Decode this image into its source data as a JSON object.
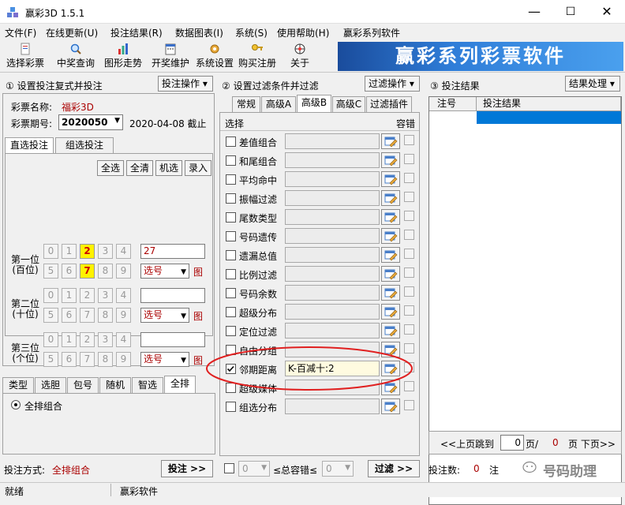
{
  "window": {
    "title": "赢彩3D 1.5.1",
    "minimize": "—",
    "maximize": "☐",
    "close": "✕"
  },
  "menu": [
    "文件(F)",
    "在线更新(U)",
    "投注结果(R)",
    "数据图表(I)",
    "系统(S)",
    "使用帮助(H)",
    "赢彩系列软件"
  ],
  "toolbar": {
    "select": "选择彩票",
    "winquery": "中奖查询",
    "chart": "图形走势",
    "maintain": "开奖维护",
    "settings": "系统设置",
    "buy": "购买注册",
    "about": "关于",
    "banner": "赢彩系列彩票软件"
  },
  "left": {
    "heading": "① 设置投注复式并投注",
    "op_button": "投注操作 ▾",
    "name_label": "彩票名称:",
    "name_value": "福彩3D",
    "period_label": "彩票期号:",
    "period_value": "2020050",
    "date_text": "2020-04-08 截止",
    "tabs": [
      "直选投注",
      "组选投注"
    ],
    "btn_all": "全选",
    "btn_clear": "全清",
    "btn_random": "机选",
    "btn_enter": "录入",
    "positions": [
      {
        "line1": "第一位",
        "line2": "(百位)",
        "input": "27",
        "select": "选号",
        "fig": "图"
      },
      {
        "line1": "第二位",
        "line2": "(十位)",
        "input": "",
        "select": "选号",
        "fig": "图"
      },
      {
        "line1": "第三位",
        "line2": "(个位)",
        "input": "",
        "select": "选号",
        "fig": "图"
      }
    ],
    "digits_row1": [
      "0",
      "1",
      "2",
      "3",
      "4"
    ],
    "digits_row2": [
      "5",
      "6",
      "7",
      "8",
      "9"
    ],
    "bottom_tabs": [
      "类型",
      "选胆",
      "包号",
      "随机",
      "智选",
      "全排"
    ],
    "radio_label": "全排组合",
    "bet_mode_label": "投注方式:",
    "bet_mode_value": "全排组合",
    "bet_button": "投注 >>"
  },
  "middle": {
    "heading": "② 设置过滤条件并过滤",
    "op_button": "过滤操作 ▾",
    "tabs": [
      "常规",
      "高级A",
      "高级B",
      "高级C",
      "过滤插件"
    ],
    "col_select": "选择",
    "col_tolerance": "容错",
    "filters": [
      {
        "label": "差值组合",
        "value": "",
        "checked": false
      },
      {
        "label": "和尾组合",
        "value": "",
        "checked": false
      },
      {
        "label": "平均命中",
        "value": "",
        "checked": false
      },
      {
        "label": "振幅过滤",
        "value": "",
        "checked": false
      },
      {
        "label": "尾数类型",
        "value": "",
        "checked": false
      },
      {
        "label": "号码遗传",
        "value": "",
        "checked": false
      },
      {
        "label": "遗漏总值",
        "value": "",
        "checked": false
      },
      {
        "label": "比例过滤",
        "value": "",
        "checked": false
      },
      {
        "label": "号码余数",
        "value": "",
        "checked": false
      },
      {
        "label": "超级分布",
        "value": "",
        "checked": false
      },
      {
        "label": "定位过滤",
        "value": "",
        "checked": false
      },
      {
        "label": "自由分组",
        "value": "",
        "checked": false
      },
      {
        "label": "邻期距离",
        "value": "K-百减十:2",
        "checked": true
      },
      {
        "label": "超级媒体",
        "value": "",
        "checked": false
      },
      {
        "label": "组选分布",
        "value": "",
        "checked": false
      }
    ],
    "total_tol_label": "≤总容错≤",
    "tol_min": "0",
    "tol_max": "0",
    "filter_button": "过滤 >>"
  },
  "right": {
    "heading": "③ 投注结果",
    "op_button": "结果处理 ▾",
    "col_no": "注号",
    "col_result": "投注结果",
    "prev": "<<上页",
    "jump": "跳到",
    "page_value": "0",
    "page_of": "页/",
    "total_pages": "0",
    "next": "页 下页>>",
    "count_label": "投注数:",
    "count_value": "0",
    "count_unit": "注"
  },
  "status": {
    "left": "就绪",
    "right": "赢彩软件"
  },
  "watermark": "号码助理"
}
